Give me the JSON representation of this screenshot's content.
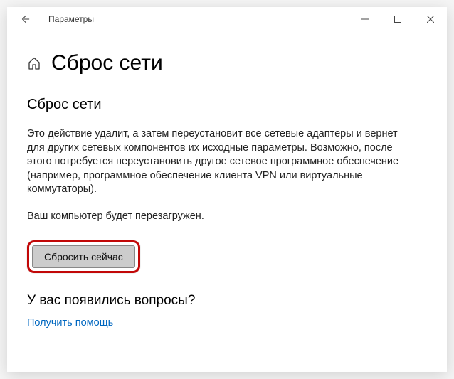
{
  "titlebar": {
    "app_name": "Параметры"
  },
  "page": {
    "title": "Сброс сети"
  },
  "main": {
    "section_title": "Сброс сети",
    "description": "Это действие удалит, а затем переустановит все сетевые адаптеры и вернет для других сетевых компонентов их исходные параметры. Возможно, после этого потребуется переустановить другое сетевое программное обеспечение (например, программное обеспечение клиента VPN или виртуальные коммутаторы).",
    "restart_note": "Ваш компьютер будет перезагружен.",
    "reset_button": "Сбросить сейчас"
  },
  "help": {
    "question_title": "У вас появились вопросы?",
    "link": "Получить помощь"
  }
}
